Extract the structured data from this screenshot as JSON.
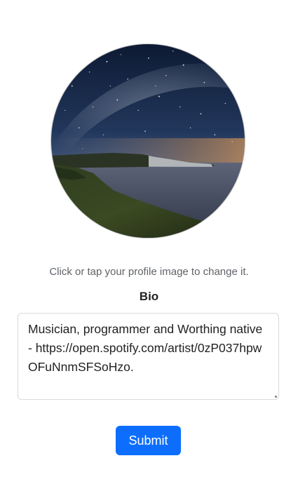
{
  "profile": {
    "image_alt": "Starry night sky over coastal cliffs",
    "hint": "Click or tap your profile image to change it."
  },
  "bio": {
    "label": "Bio",
    "value": "Musician, programmer and Worthing native - https://open.spotify.com/artist/0zP037hpwOFuNnmSFSoHzo."
  },
  "form": {
    "submit_label": "Submit"
  },
  "colors": {
    "accent": "#0d6efd",
    "hint_text": "#5f6368",
    "border": "#dadada"
  }
}
